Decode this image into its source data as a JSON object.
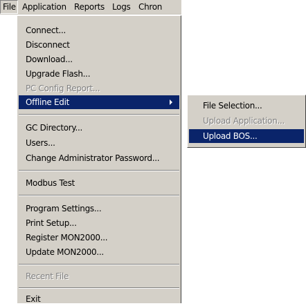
{
  "menubar": {
    "items": [
      "File",
      "Application",
      "Reports",
      "Logs",
      "Chron"
    ]
  },
  "file_menu": {
    "items": [
      {
        "label": "Connect...",
        "enabled": true
      },
      {
        "label": "Disconnect",
        "enabled": true
      },
      {
        "label": "Download...",
        "enabled": true
      },
      {
        "label": "Upgrade Flash...",
        "enabled": true
      },
      {
        "label": "PC Config Report...",
        "enabled": false
      },
      {
        "label": "Offline Edit",
        "enabled": true,
        "highlighted": true,
        "has_submenu": true
      },
      {
        "label": "GC Directory...",
        "enabled": true
      },
      {
        "label": "Users...",
        "enabled": true
      },
      {
        "label": "Change Administrator Password...",
        "enabled": true
      },
      {
        "label": "Modbus Test",
        "enabled": true
      },
      {
        "label": "Program Settings...",
        "enabled": true
      },
      {
        "label": "Print Setup...",
        "enabled": true
      },
      {
        "label": "Register MON2000...",
        "enabled": true
      },
      {
        "label": "Update MON2000...",
        "enabled": true
      },
      {
        "label": "Recent File",
        "enabled": false
      },
      {
        "label": "Exit",
        "enabled": true
      }
    ]
  },
  "offline_edit_submenu": {
    "items": [
      {
        "label": "File Selection...",
        "enabled": true
      },
      {
        "label": "Upload Application...",
        "enabled": false
      },
      {
        "label": "Upload BOS...",
        "enabled": true,
        "highlighted": true
      }
    ]
  },
  "colors": {
    "menu_face": "#d4d0c8",
    "highlight": "#0a246a",
    "disabled_text": "#808080"
  },
  "icons": [
    "chevron-right-icon"
  ]
}
